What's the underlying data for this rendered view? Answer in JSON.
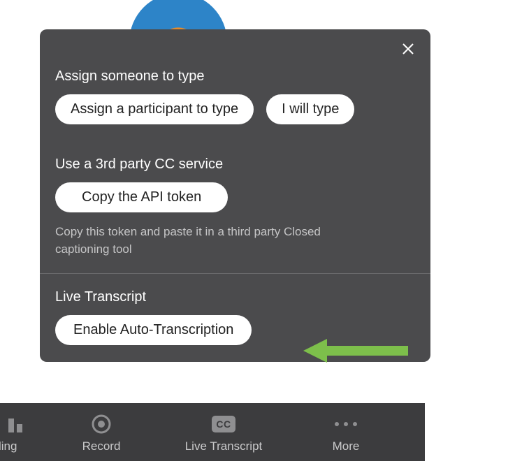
{
  "popup": {
    "section1": {
      "heading": "Assign someone to type",
      "assign_participant_label": "Assign a participant to type",
      "i_will_type_label": "I will type"
    },
    "section2": {
      "heading": "Use a 3rd party CC service",
      "copy_token_label": "Copy the API token",
      "helper_text": "Copy this token and paste it in a third party Closed captioning tool"
    },
    "section3": {
      "heading": "Live Transcript",
      "enable_auto_label": "Enable Auto-Transcription"
    }
  },
  "toolbar": {
    "polling_label": "ling",
    "record_label": "Record",
    "transcript_label": "Live Transcript",
    "more_label": "More",
    "cc_badge": "CC"
  },
  "colors": {
    "popup_bg": "#4b4b4d",
    "toolbar_bg": "#3c3c3e",
    "arrow": "#7dbf4b"
  }
}
